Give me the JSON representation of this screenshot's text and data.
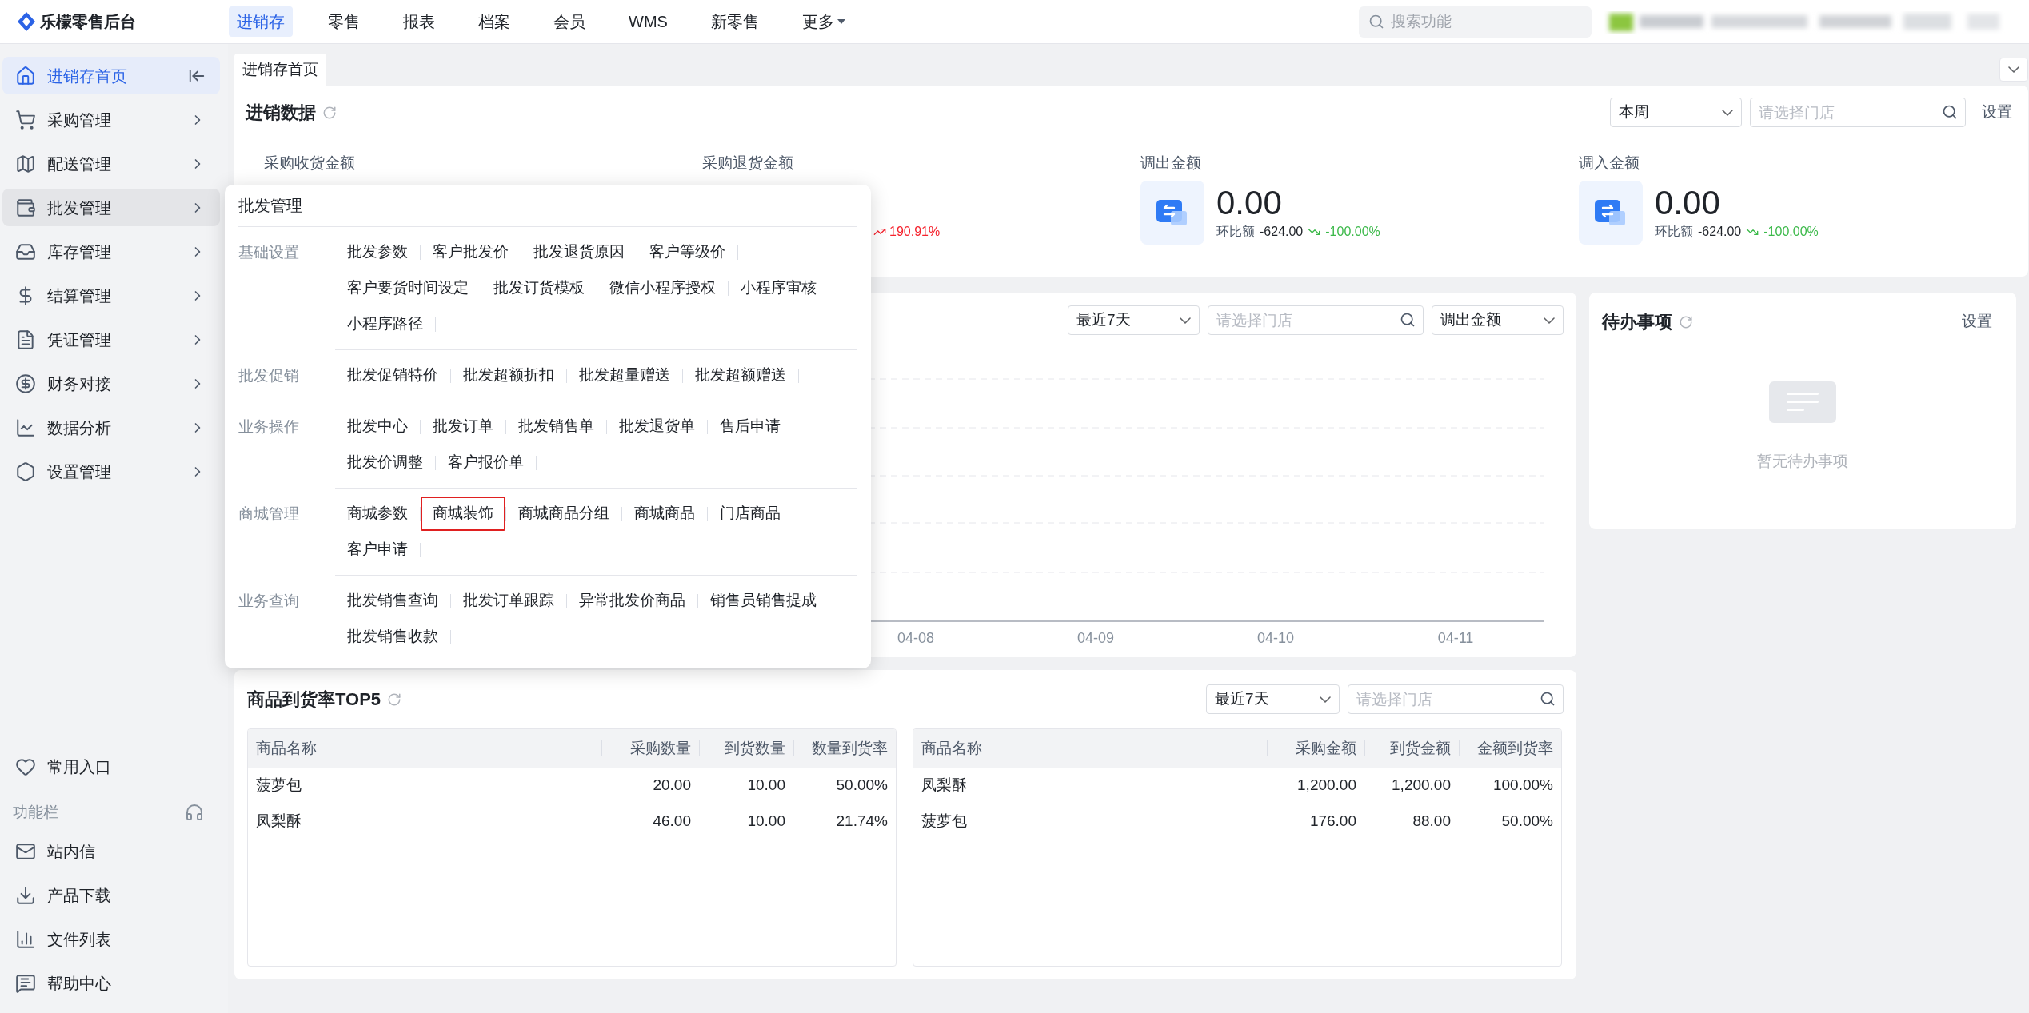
{
  "top_bar": {
    "logo": "乐檬零售后台",
    "nav": [
      {
        "label": "进销存",
        "selected": true,
        "has_menu": false
      },
      {
        "label": "零售",
        "selected": false,
        "has_menu": false
      },
      {
        "label": "报表",
        "selected": false,
        "has_menu": false
      },
      {
        "label": "档案",
        "selected": false,
        "has_menu": false
      },
      {
        "label": "会员",
        "selected": false,
        "has_menu": false
      },
      {
        "label": "WMS",
        "selected": false,
        "has_menu": false
      },
      {
        "label": "新零售",
        "selected": false,
        "has_menu": false
      },
      {
        "label": "更多",
        "selected": false,
        "has_menu": true
      }
    ],
    "search": {
      "placeholder": "搜索功能"
    }
  },
  "sidebar": {
    "items": [
      {
        "label": "进销存首页",
        "kind": "pinned",
        "selected": true,
        "expanded": false
      },
      {
        "label": "采购管理",
        "kind": "submenu",
        "selected": false,
        "expanded": false
      },
      {
        "label": "配送管理",
        "kind": "submenu",
        "selected": false,
        "expanded": false
      },
      {
        "label": "批发管理",
        "kind": "submenu",
        "selected": false,
        "expanded": true
      },
      {
        "label": "库存管理",
        "kind": "submenu",
        "selected": false,
        "expanded": false
      },
      {
        "label": "结算管理",
        "kind": "submenu",
        "selected": false,
        "expanded": false
      },
      {
        "label": "凭证管理",
        "kind": "submenu",
        "selected": false,
        "expanded": false
      },
      {
        "label": "财务对接",
        "kind": "submenu",
        "selected": false,
        "expanded": false
      },
      {
        "label": "数据分析",
        "kind": "submenu",
        "selected": false,
        "expanded": false
      },
      {
        "label": "设置管理",
        "kind": "submenu",
        "selected": false,
        "expanded": false
      }
    ],
    "favorites": "常用入口",
    "function_bar": "功能栏",
    "tools": [
      "站内信",
      "产品下载",
      "文件列表",
      "帮助中心"
    ]
  },
  "tab_strip": {
    "tabs": [
      {
        "label": "进销存首页",
        "selected": true
      }
    ]
  },
  "sales_data": {
    "title": "进销数据",
    "period_select": "本周",
    "store_search": {
      "placeholder": "请选择门店"
    },
    "settings": "设置",
    "cards": [
      {
        "kind": "label_only",
        "label": "采购收货金额"
      },
      {
        "kind": "partial",
        "label": "采购退货金额",
        "change_pct": "190.91%",
        "increase": true
      },
      {
        "kind": "full",
        "label": "调出金额",
        "value": "0.00",
        "change_label": "环比额",
        "change_amount": "-624.00",
        "change_pct": "-100.00%",
        "increase": false
      },
      {
        "kind": "full",
        "label": "调入金额",
        "value": "0.00",
        "change_label": "环比额",
        "change_amount": "-624.00",
        "change_pct": "-100.00%",
        "increase": false
      }
    ]
  },
  "chart_panel": {
    "period_select": "最近7天",
    "store_search": {
      "placeholder": "请选择门店"
    },
    "metric_select": "调出金额",
    "x_labels": [
      "04-08",
      "04-09",
      "04-10",
      "04-11"
    ]
  },
  "todo": {
    "title": "待办事项",
    "settings": "设置",
    "empty_text": "暂无待办事项"
  },
  "top5": {
    "title": "商品到货率TOP5",
    "period_select": "最近7天",
    "store_search": {
      "placeholder": "请选择门店"
    },
    "tables": [
      {
        "columns": [
          "商品名称",
          "采购数量",
          "到货数量",
          "数量到货率"
        ],
        "rows": [
          [
            "菠萝包",
            "20.00",
            "10.00",
            "50.00%"
          ],
          [
            "凤梨酥",
            "46.00",
            "10.00",
            "21.74%"
          ]
        ]
      },
      {
        "columns": [
          "商品名称",
          "采购金额",
          "到货金额",
          "金额到货率"
        ],
        "rows": [
          [
            "凤梨酥",
            "1,200.00",
            "1,200.00",
            "100.00%"
          ],
          [
            "菠萝包",
            "176.00",
            "88.00",
            "50.00%"
          ]
        ]
      }
    ]
  },
  "popup": {
    "title": "批发管理",
    "groups": [
      {
        "label": "基础设置",
        "items": [
          {
            "label": "批发参数",
            "selected": false
          },
          {
            "label": "客户批发价",
            "selected": false
          },
          {
            "label": "批发退货原因",
            "selected": false
          },
          {
            "label": "客户等级价",
            "selected": false
          },
          {
            "label": "客户要货时间设定",
            "selected": false
          },
          {
            "label": "批发订货模板",
            "selected": false
          },
          {
            "label": "微信小程序授权",
            "selected": false
          },
          {
            "label": "小程序审核",
            "selected": false
          },
          {
            "label": "小程序路径",
            "selected": false
          }
        ]
      },
      {
        "label": "批发促销",
        "items": [
          {
            "label": "批发促销特价",
            "selected": false
          },
          {
            "label": "批发超额折扣",
            "selected": false
          },
          {
            "label": "批发超量赠送",
            "selected": false
          },
          {
            "label": "批发超额赠送",
            "selected": false
          }
        ]
      },
      {
        "label": "业务操作",
        "items": [
          {
            "label": "批发中心",
            "selected": false
          },
          {
            "label": "批发订单",
            "selected": false
          },
          {
            "label": "批发销售单",
            "selected": false
          },
          {
            "label": "批发退货单",
            "selected": false
          },
          {
            "label": "售后申请",
            "selected": false
          },
          {
            "label": "批发价调整",
            "selected": false
          },
          {
            "label": "客户报价单",
            "selected": false
          }
        ]
      },
      {
        "label": "商城管理",
        "items": [
          {
            "label": "商城参数",
            "selected": false
          },
          {
            "label": "商城装饰",
            "selected": true
          },
          {
            "label": "商城商品分组",
            "selected": false
          },
          {
            "label": "商城商品",
            "selected": false
          },
          {
            "label": "门店商品",
            "selected": false
          },
          {
            "label": "客户申请",
            "selected": false
          }
        ]
      },
      {
        "label": "业务查询",
        "items": [
          {
            "label": "批发销售查询",
            "selected": false
          },
          {
            "label": "批发订单跟踪",
            "selected": false
          },
          {
            "label": "异常批发价商品",
            "selected": false
          },
          {
            "label": "销售员销售提成",
            "selected": false
          },
          {
            "label": "批发销售收款",
            "selected": false
          }
        ]
      }
    ]
  }
}
